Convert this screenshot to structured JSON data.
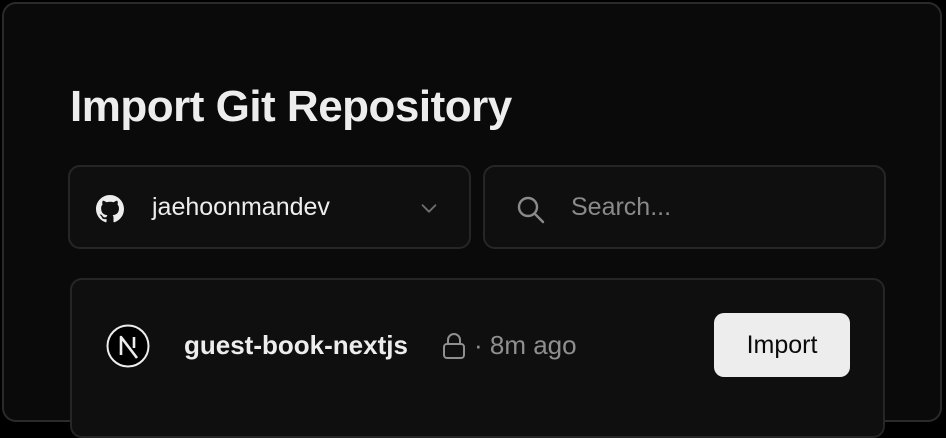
{
  "header": {
    "title": "Import Git Repository"
  },
  "scope": {
    "icon": "github-icon",
    "label": "jaehoonmandev",
    "chevron": "chevron-down-icon"
  },
  "search": {
    "icon": "search-icon",
    "placeholder": "Search...",
    "value": ""
  },
  "repos": [
    {
      "icon": "nextjs-logo-icon",
      "name": "guest-book-nextjs",
      "private": true,
      "private_icon": "lock-icon",
      "meta": "· 8m ago",
      "action_label": "Import"
    }
  ],
  "colors": {
    "background": "#000000",
    "card": "#0a0a0a",
    "border": "#262626",
    "text": "#ededed",
    "muted": "#8f8f8f",
    "button_bg": "#ededed",
    "button_text": "#0a0a0a"
  }
}
